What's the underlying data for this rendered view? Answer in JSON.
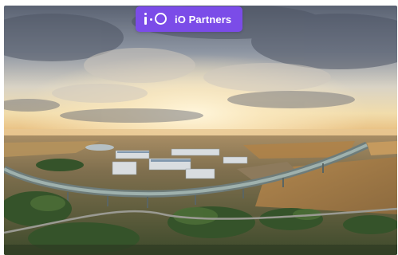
{
  "badge": {
    "label": "iO Partners",
    "logo_icon": "io-logo-icon",
    "color": "#7b4ce8"
  },
  "photo": {
    "subject": "aerial-photo",
    "palette": {
      "sky_top": "#5d6677",
      "sky_glow": "#f6e9c4",
      "horizon": "#e9c58c",
      "fields": "#b89a66",
      "greenery": "#3f5f30",
      "bridge": "#7f8f8c"
    }
  }
}
